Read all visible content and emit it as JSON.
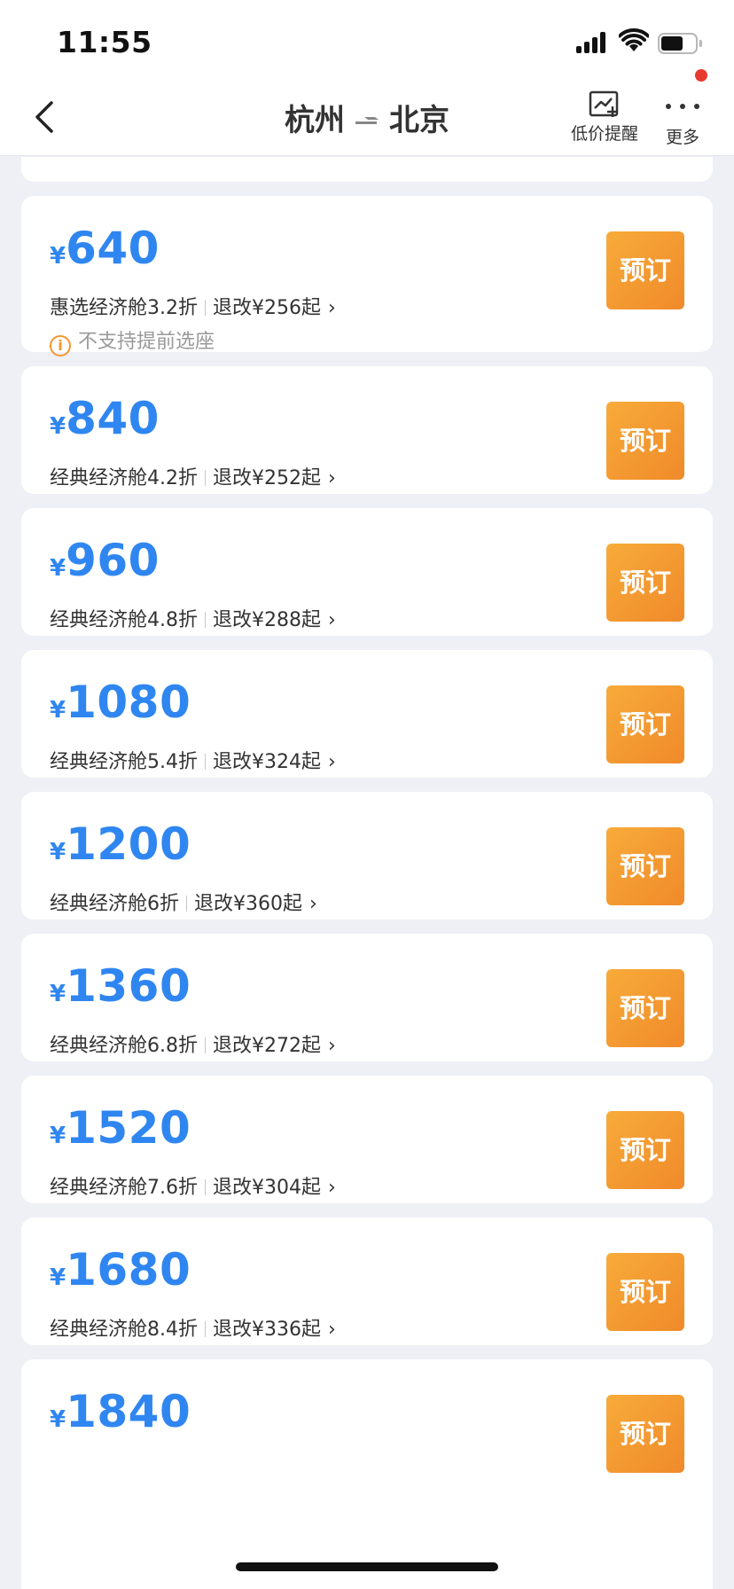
{
  "status_bar": {
    "time": "11:55"
  },
  "nav": {
    "origin": "杭州",
    "destination": "北京",
    "price_alert_label": "低价提醒",
    "more_label": "更多"
  },
  "currency_symbol": "¥",
  "book_label": "预订",
  "fares": [
    {
      "price": "640",
      "cabin": "惠选经济舱3.2折",
      "refund": "退改¥256起",
      "note": "不支持提前选座"
    },
    {
      "price": "840",
      "cabin": "经典经济舱4.2折",
      "refund": "退改¥252起"
    },
    {
      "price": "960",
      "cabin": "经典经济舱4.8折",
      "refund": "退改¥288起"
    },
    {
      "price": "1080",
      "cabin": "经典经济舱5.4折",
      "refund": "退改¥324起"
    },
    {
      "price": "1200",
      "cabin": "经典经济舱6折",
      "refund": "退改¥360起"
    },
    {
      "price": "1360",
      "cabin": "经典经济舱6.8折",
      "refund": "退改¥272起"
    },
    {
      "price": "1520",
      "cabin": "经典经济舱7.6折",
      "refund": "退改¥304起"
    },
    {
      "price": "1680",
      "cabin": "经典经济舱8.4折",
      "refund": "退改¥336起"
    },
    {
      "price": "1840"
    }
  ],
  "colors": {
    "price_blue": "#2f86f0",
    "book_orange": "#f08a2a",
    "info_orange": "#f5962f",
    "badge_red": "#e8392f"
  }
}
